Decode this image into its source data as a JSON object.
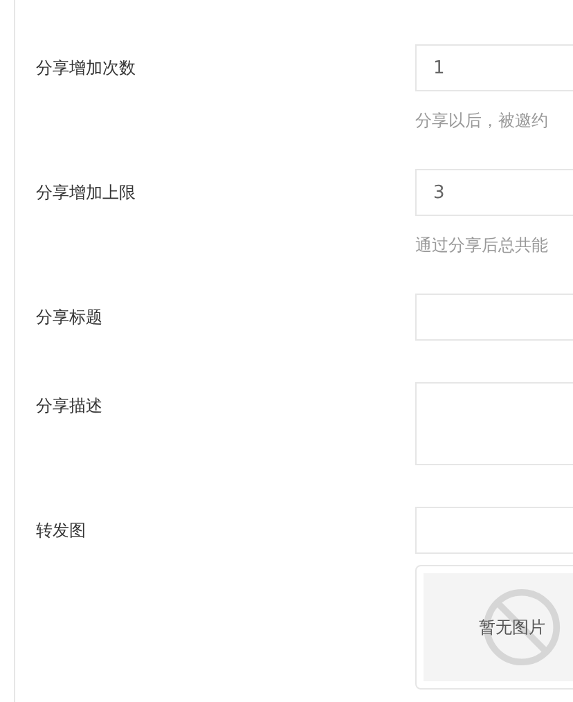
{
  "fields": [
    {
      "kind": "input",
      "label": "分享增加次数",
      "value": "1",
      "help": "分享以后，被邀约"
    },
    {
      "kind": "input",
      "label": "分享增加上限",
      "value": "3",
      "help": "通过分享后总共能"
    },
    {
      "kind": "input",
      "label": "分享标题"
    },
    {
      "kind": "textarea",
      "label": "分享描述"
    },
    {
      "kind": "image",
      "label": "转发图",
      "no_image_text": "暂无图片"
    }
  ]
}
